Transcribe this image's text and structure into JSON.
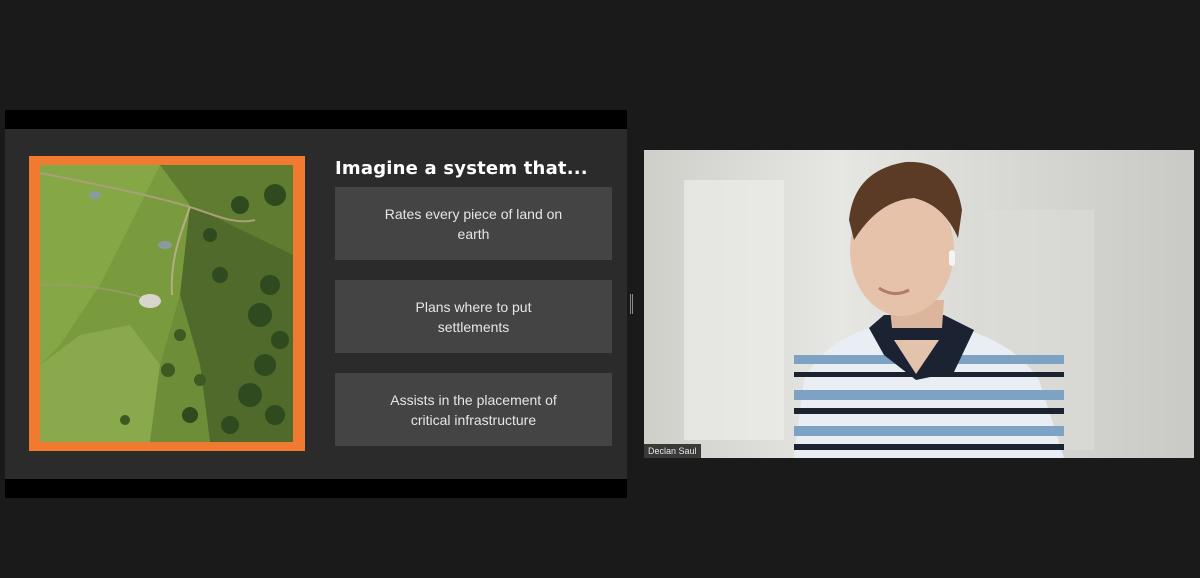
{
  "slide": {
    "title": "Imagine a system that...",
    "cards": [
      {
        "label": "Rates every piece of land on earth"
      },
      {
        "label": "Plans where to put settlements"
      },
      {
        "label": "Assists in the placement of critical infrastructure"
      }
    ],
    "accent_color": "#ef7a30"
  },
  "participant": {
    "name": "Declan Saul"
  }
}
